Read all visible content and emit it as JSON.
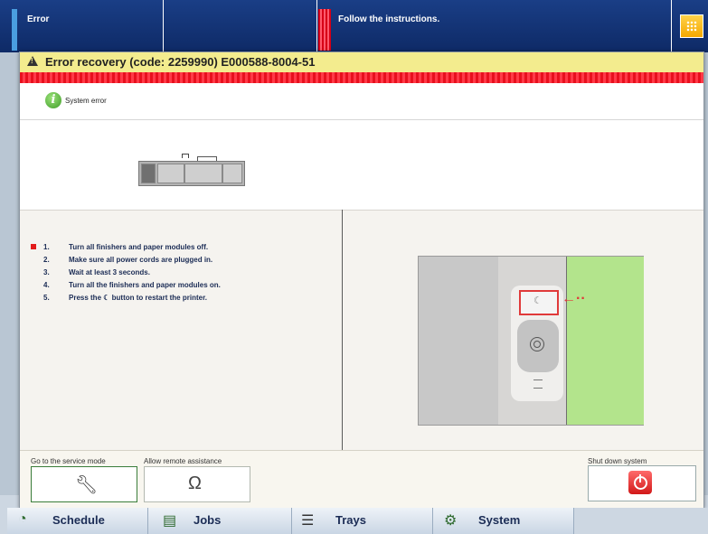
{
  "statusbar": {
    "left_label": "Error",
    "message": "Follow the instructions."
  },
  "dialog": {
    "title": "Error recovery  (code: 2259990) E000588-8004-51",
    "system_status": "System error",
    "steps": [
      {
        "num": "1.",
        "text": "Turn all finishers and paper modules off."
      },
      {
        "num": "2.",
        "text": "Make sure all power cords are plugged in."
      },
      {
        "num": "3.",
        "text": "Wait at least 3 seconds."
      },
      {
        "num": "4.",
        "text": "Turn all the finishers and paper modules on."
      },
      {
        "num": "5.",
        "text": "Press the ☾ button to restart the printer."
      }
    ],
    "buttons": {
      "service_mode_label": "Go to the service mode",
      "remote_assistance_label": "Allow remote assistance",
      "shutdown_label": "Shut down system"
    }
  },
  "nav": {
    "tabs": [
      {
        "label": "Schedule",
        "icon": "schedule-icon"
      },
      {
        "label": "Jobs",
        "icon": "jobs-icon"
      },
      {
        "label": "Trays",
        "icon": "trays-icon"
      },
      {
        "label": "System",
        "icon": "system-gear-icon"
      }
    ]
  }
}
